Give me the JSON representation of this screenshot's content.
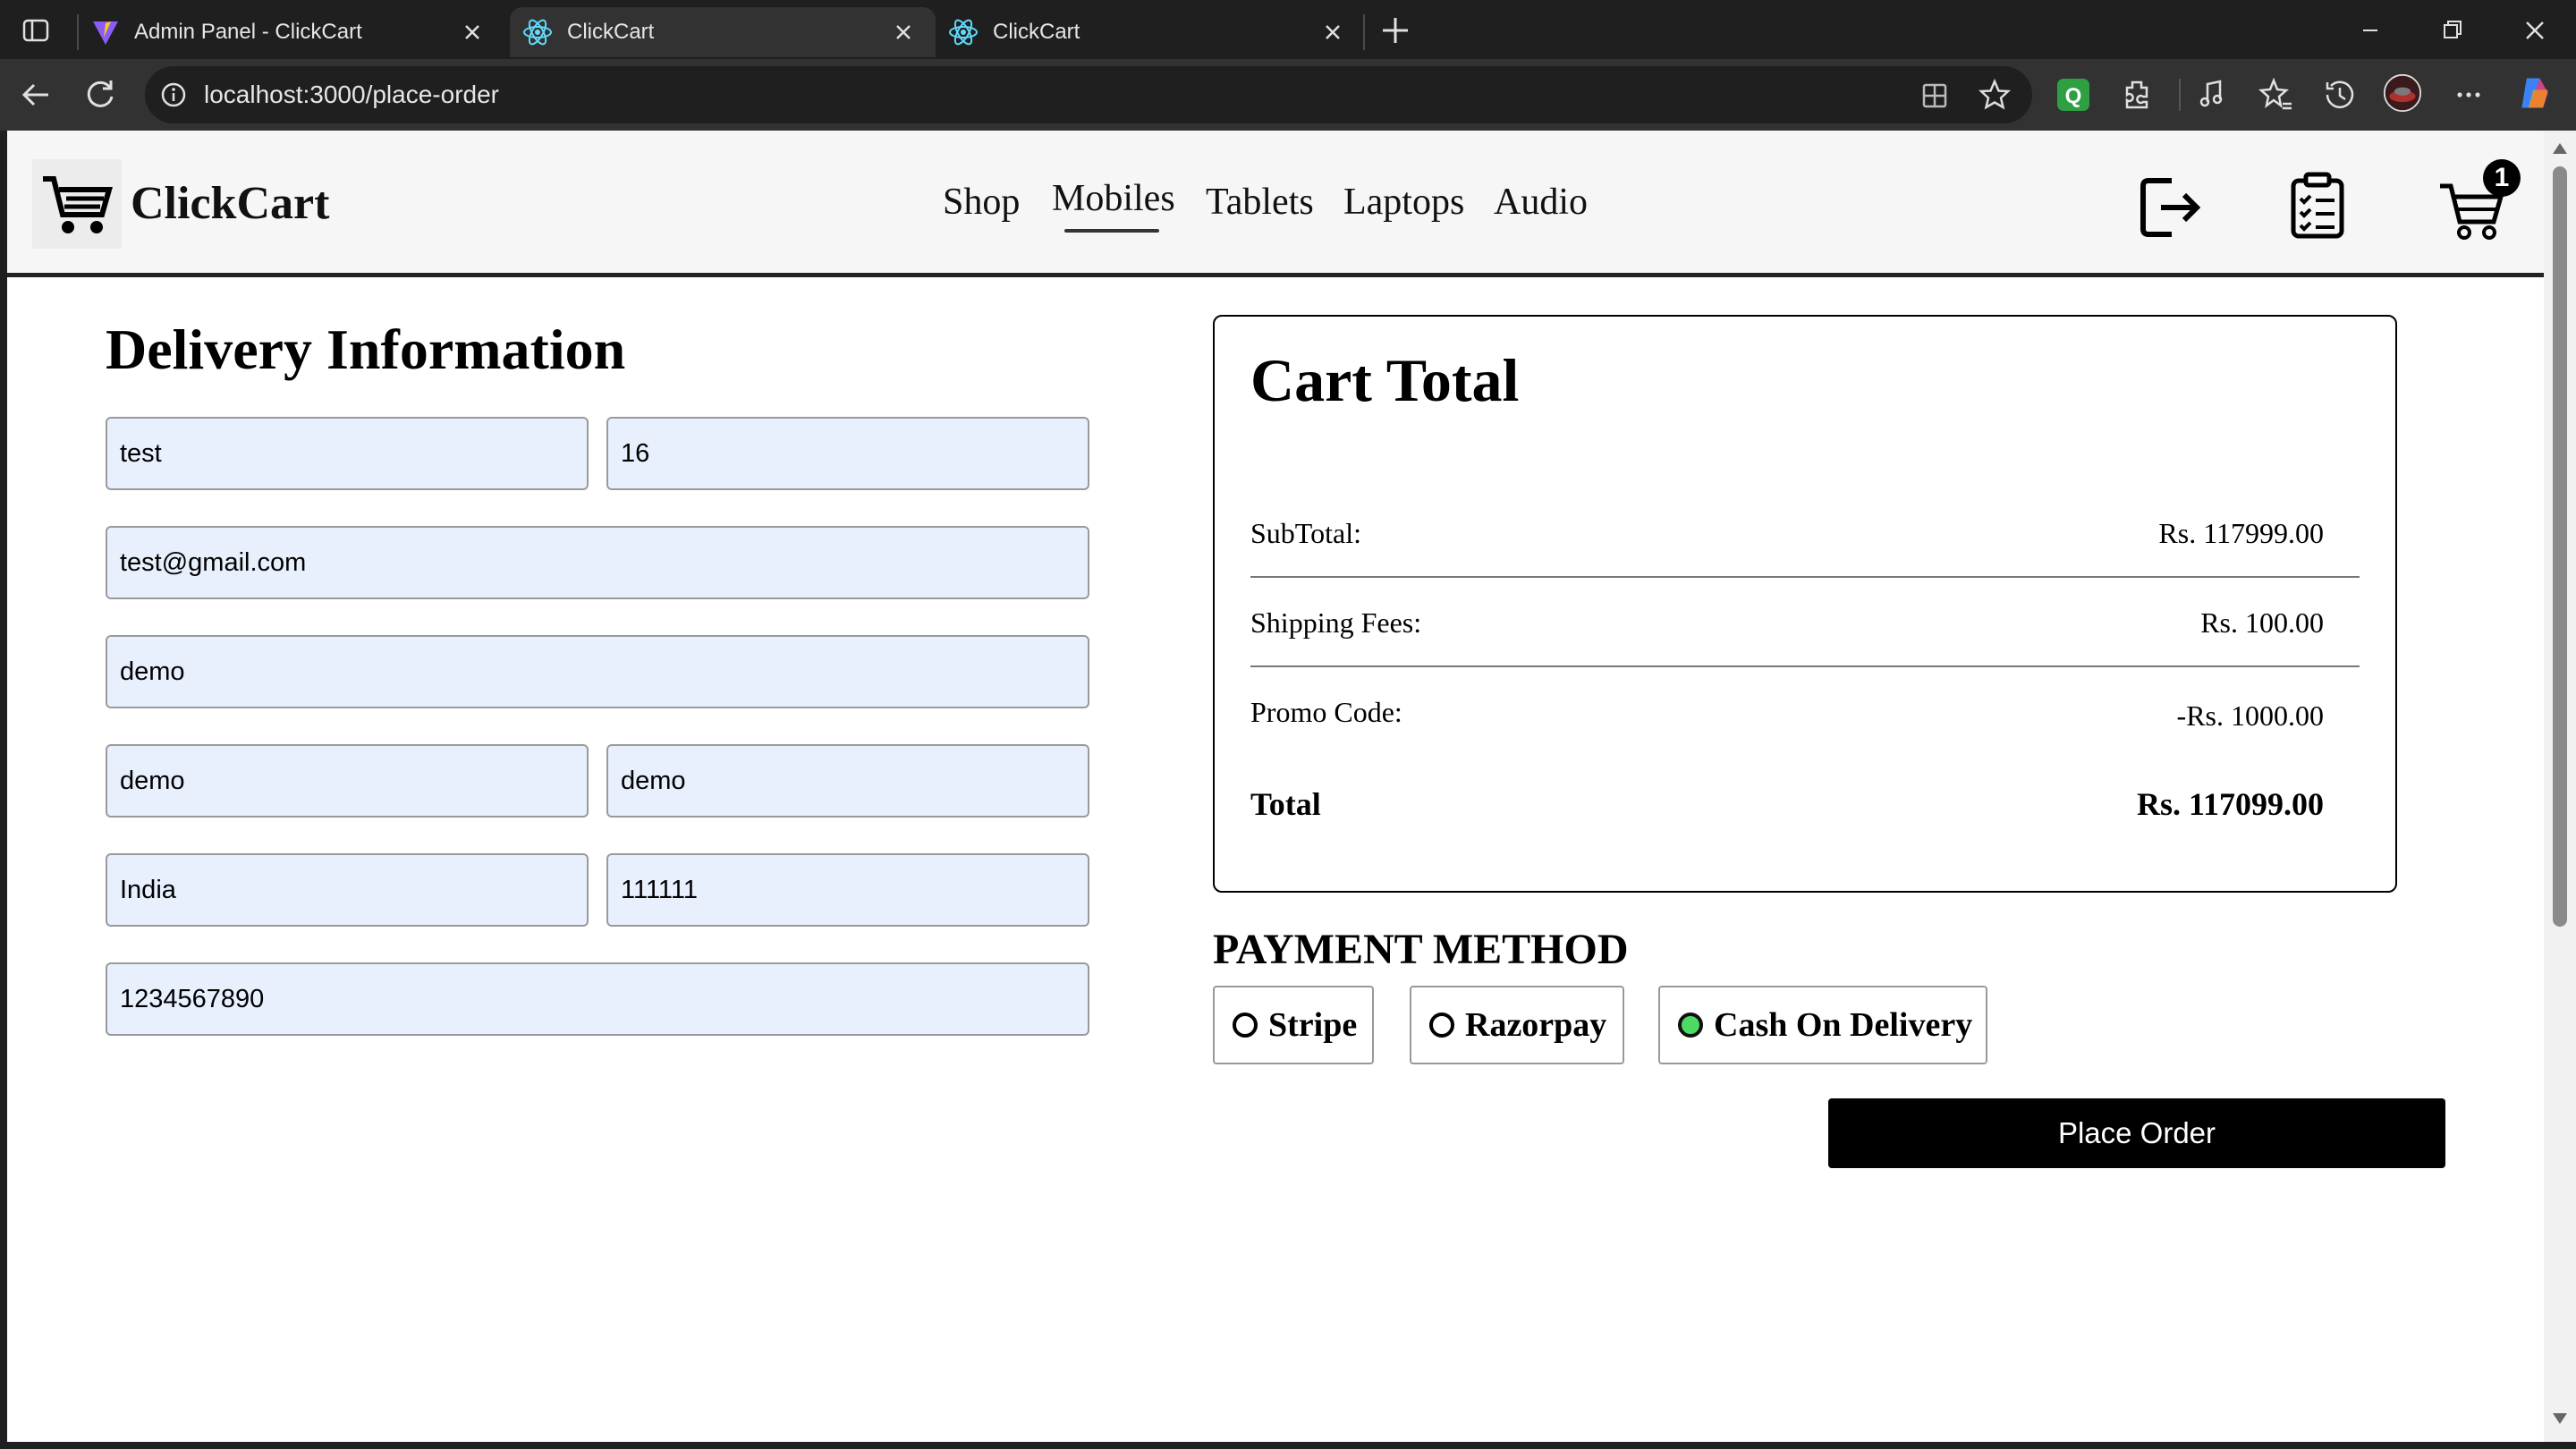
{
  "browser": {
    "tabs": [
      {
        "title": "Admin Panel - ClickCart",
        "active": false,
        "icon": "vite-logo-icon"
      },
      {
        "title": "ClickCart",
        "active": true,
        "icon": "react-logo-icon"
      },
      {
        "title": "ClickCart",
        "active": false,
        "icon": "react-logo-icon"
      }
    ],
    "url": "localhost:3000/place-order"
  },
  "navbar": {
    "brand": "ClickCart",
    "links": [
      "Shop",
      "Mobiles",
      "Tablets",
      "Laptops",
      "Audio"
    ],
    "active_link": "Mobiles",
    "cart_count": "1"
  },
  "delivery": {
    "title": "Delivery Information",
    "fields": {
      "first_name": "test",
      "last_name": "16",
      "email": "test@gmail.com",
      "street": "demo",
      "city": "demo",
      "state": "demo",
      "country": "India",
      "zipcode": "111111",
      "phone": "1234567890"
    }
  },
  "cart_total": {
    "title": "Cart Total",
    "subtotal_label": "SubTotal:",
    "subtotal_value": "Rs. 117999.00",
    "shipping_label": "Shipping Fees:",
    "shipping_value": "Rs. 100.00",
    "promo_label": "Promo Code:",
    "promo_value": "-Rs. 1000.00",
    "total_label": "Total",
    "total_value": "Rs. 117099.00"
  },
  "payment": {
    "title": "PAYMENT METHOD",
    "options": [
      "Stripe",
      "Razorpay",
      "Cash On Delivery"
    ],
    "selected": "Cash On Delivery",
    "selected_color": "#4cd964"
  },
  "place_order_label": "Place Order"
}
